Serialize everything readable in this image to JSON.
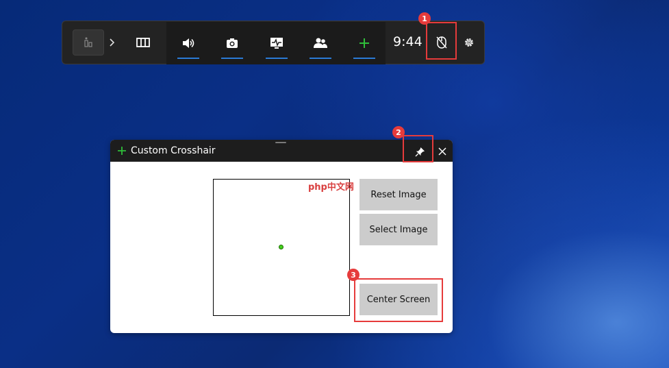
{
  "taskbar": {
    "time": "9:44",
    "icons": [
      "xbox-icon",
      "chevron-right-icon",
      "widget-icon",
      "volume-icon",
      "camera-icon",
      "performance-icon",
      "social-icon",
      "add-icon",
      "mouse-lock-icon",
      "gear-icon"
    ]
  },
  "annotations": [
    "1",
    "2",
    "3"
  ],
  "window": {
    "title": "Custom Crosshair",
    "watermark": "php中文网",
    "buttons": {
      "reset": "Reset Image",
      "select": "Select Image",
      "center": "Center Screen"
    }
  },
  "colors": {
    "accent_blue": "#2b7bd6",
    "marker_red": "#e63b3b",
    "crosshair_green": "#44d11f"
  }
}
